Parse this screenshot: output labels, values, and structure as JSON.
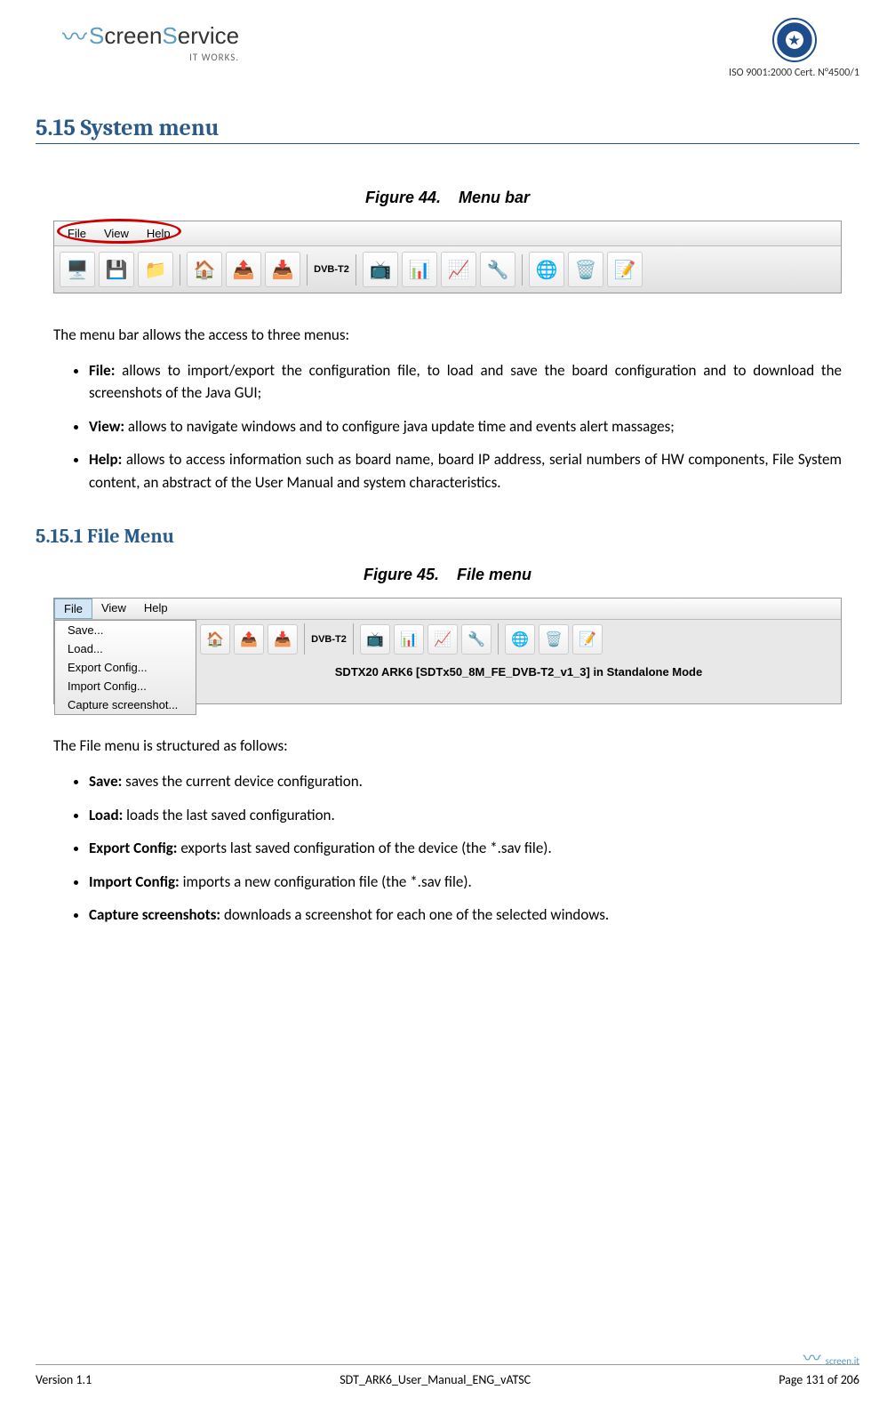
{
  "header": {
    "logo_text1": "S",
    "logo_text2": "creen",
    "logo_text3": "S",
    "logo_text4": "ervice",
    "tagline": "IT WORKS.",
    "cert": "ISO 9001:2000 Cert. N°4500/1"
  },
  "section": {
    "number": "5.15",
    "title": "System menu"
  },
  "figure44": {
    "prefix": "Figure 44.",
    "title": "Menu bar"
  },
  "menubar": {
    "file": "File",
    "view": "View",
    "help": "Help"
  },
  "toolbar": {
    "dvbt2": "DVB-T2"
  },
  "intro_text": "The menu bar allows the access to three menus:",
  "menu_descriptions": [
    {
      "label": "File:",
      "desc": " allows to import/export the configuration file, to load and save the board configuration and to download the screenshots of the Java GUI;"
    },
    {
      "label": "View:",
      "desc": " allows to navigate windows and to configure java update time and events alert massages;"
    },
    {
      "label": "Help:",
      "desc": " allows to access information such as board name, board IP address, serial numbers of HW components, File System content, an abstract of the User Manual and system characteristics."
    }
  ],
  "subsection": {
    "number": "5.15.1",
    "title": "File Menu"
  },
  "figure45": {
    "prefix": "Figure 45.",
    "title": "File menu"
  },
  "dropdown": {
    "items": [
      "Save...",
      "Load...",
      "Export Config...",
      "Import Config...",
      "Capture screenshot..."
    ]
  },
  "titlebar": "SDTX20 ARK6 [SDTx50_8M_FE_DVB-T2_v1_3] in Standalone Mode",
  "file_intro": "The File menu is structured as follows:",
  "file_items": [
    {
      "label": "Save:",
      "desc": " saves the current device configuration."
    },
    {
      "label": "Load:",
      "desc": " loads the last saved configuration."
    },
    {
      "label": "Export Config:",
      "desc": " exports last saved configuration of the device (the *.sav file)."
    },
    {
      "label": "Import Config:",
      "desc": " imports a new configuration file (the *.sav file)."
    },
    {
      "label": "Capture screenshots:",
      "desc": " downloads a screenshot for each one of the selected windows."
    }
  ],
  "footer": {
    "version": "Version 1.1",
    "doc": "SDT_ARK6_User_Manual_ENG_vATSC",
    "page": "Page 131 of 206",
    "brand": "screen.it"
  }
}
